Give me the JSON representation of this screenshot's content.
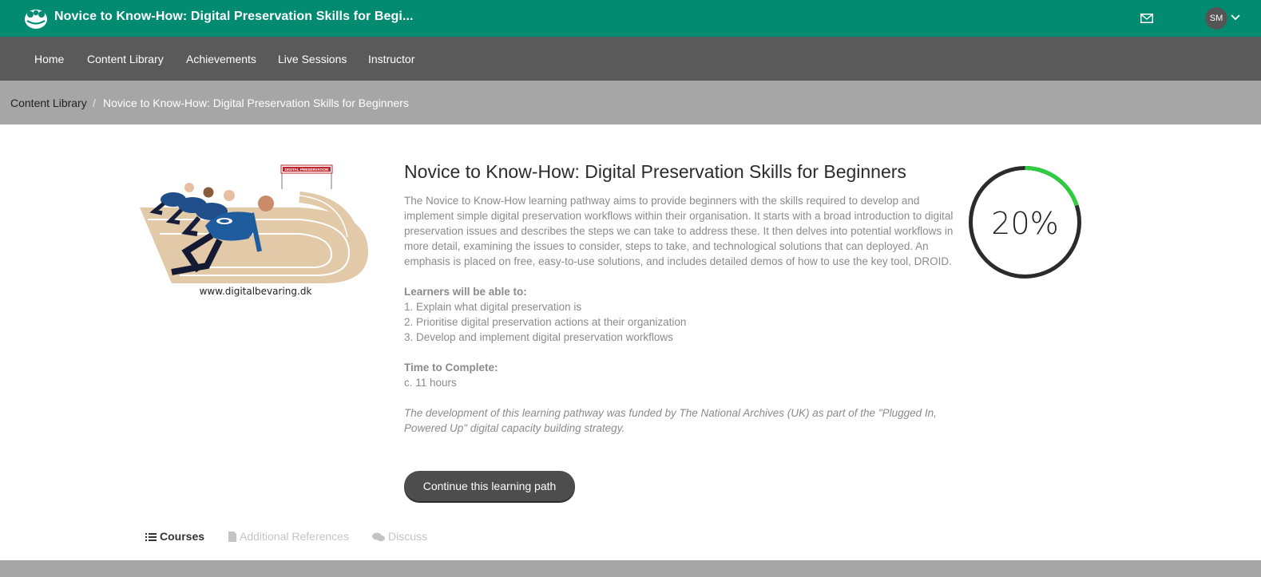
{
  "header": {
    "title": "Novice to Know-How: Digital Preservation Skills for Begi...",
    "avatar_initials": "SM",
    "brand_color": "#038b72",
    "icons": [
      "logo-icon",
      "mail-icon",
      "chevron-down-icon"
    ]
  },
  "nav": {
    "items": [
      "Home",
      "Content Library",
      "Achievements",
      "Live Sessions",
      "Instructor"
    ]
  },
  "breadcrumb": {
    "link": "Content Library",
    "separator": "/",
    "current": "Novice to Know-How: Digital Preservation Skills for Beginners"
  },
  "hero": {
    "sign_text": "DIGITAL PRESERVATION",
    "caption": "www.digitalbevaring.dk"
  },
  "course": {
    "title": "Novice to Know-How: Digital Preservation Skills for Beginners",
    "description": "The Novice to Know-How learning pathway aims to provide beginners with the skills required to develop and implement simple digital preservation workflows within their organisation. It starts with a broad introduction to digital preservation issues and describes the steps we can take to address these. It then delves into potential workflows in more detail, examining the issues to consider, steps to take, and technological solutions that can deployed. An emphasis is placed on free, easy-to-use solutions, and includes detailed demos of how to use the key tool, DROID.",
    "learners_label": "Learners will be able to:",
    "outcomes": [
      "1. Explain what digital preservation is",
      "2. Prioritise digital preservation actions at their organization",
      "3. Develop and implement digital preservation workflows"
    ],
    "time_label": "Time to Complete:",
    "time_value": "c. 11 hours",
    "funding_note": "The development of this learning pathway was funded by The National Archives (UK) as part of the \"Plugged In, Powered Up\" digital capacity building strategy.",
    "cta_label": "Continue this learning path"
  },
  "progress": {
    "percent_value": 20,
    "label": "20%",
    "fill_color": "#2ecc40",
    "track_color": "#2b2b2b"
  },
  "tabs": {
    "courses": "Courses",
    "references": "Additional References",
    "discuss": "Discuss"
  }
}
